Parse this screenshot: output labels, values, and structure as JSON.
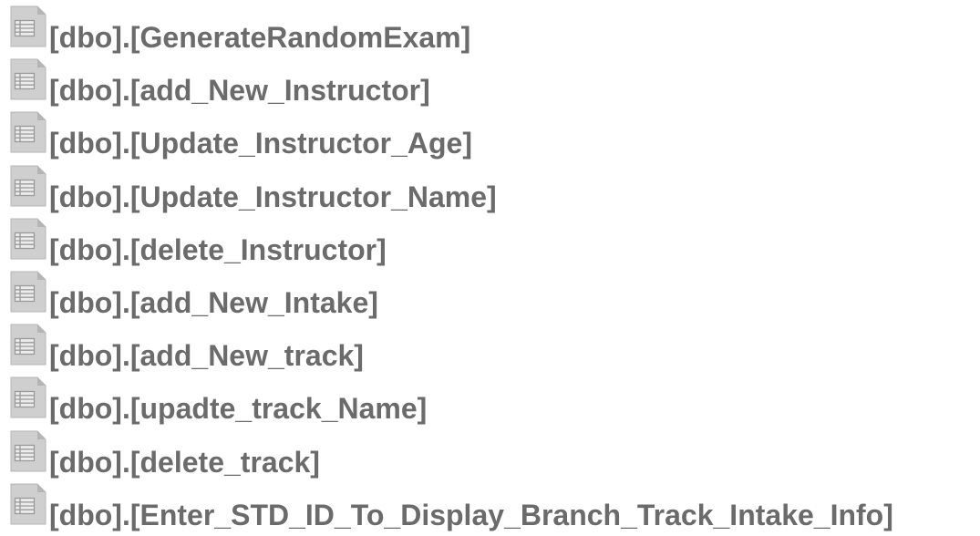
{
  "items": [
    {
      "label": "[dbo].[GenerateRandomExam]",
      "icon": "table-document-icon"
    },
    {
      "label": "[dbo].[add_New_Instructor]",
      "icon": "table-document-icon"
    },
    {
      "label": "[dbo].[Update_Instructor_Age]",
      "icon": "table-document-icon"
    },
    {
      "label": "[dbo].[Update_Instructor_Name]",
      "icon": "table-document-icon"
    },
    {
      "label": "[dbo].[delete_Instructor]",
      "icon": "table-document-icon"
    },
    {
      "label": "[dbo].[add_New_Intake]",
      "icon": "table-document-icon"
    },
    {
      "label": "[dbo].[add_New_track]",
      "icon": "table-document-icon"
    },
    {
      "label": "[dbo].[upadte_track_Name]",
      "icon": "table-document-icon"
    },
    {
      "label": "[dbo].[delete_track]",
      "icon": "table-document-icon"
    },
    {
      "label": "[dbo].[Enter_STD_ID_To_Display_Branch_Track_Intake_Info]",
      "icon": "table-document-icon"
    }
  ],
  "colors": {
    "text": "#6b6b6b",
    "icon_fill": "#cfcfcf",
    "icon_fold": "#b5b5b5",
    "icon_grid": "#9a9a9a"
  }
}
